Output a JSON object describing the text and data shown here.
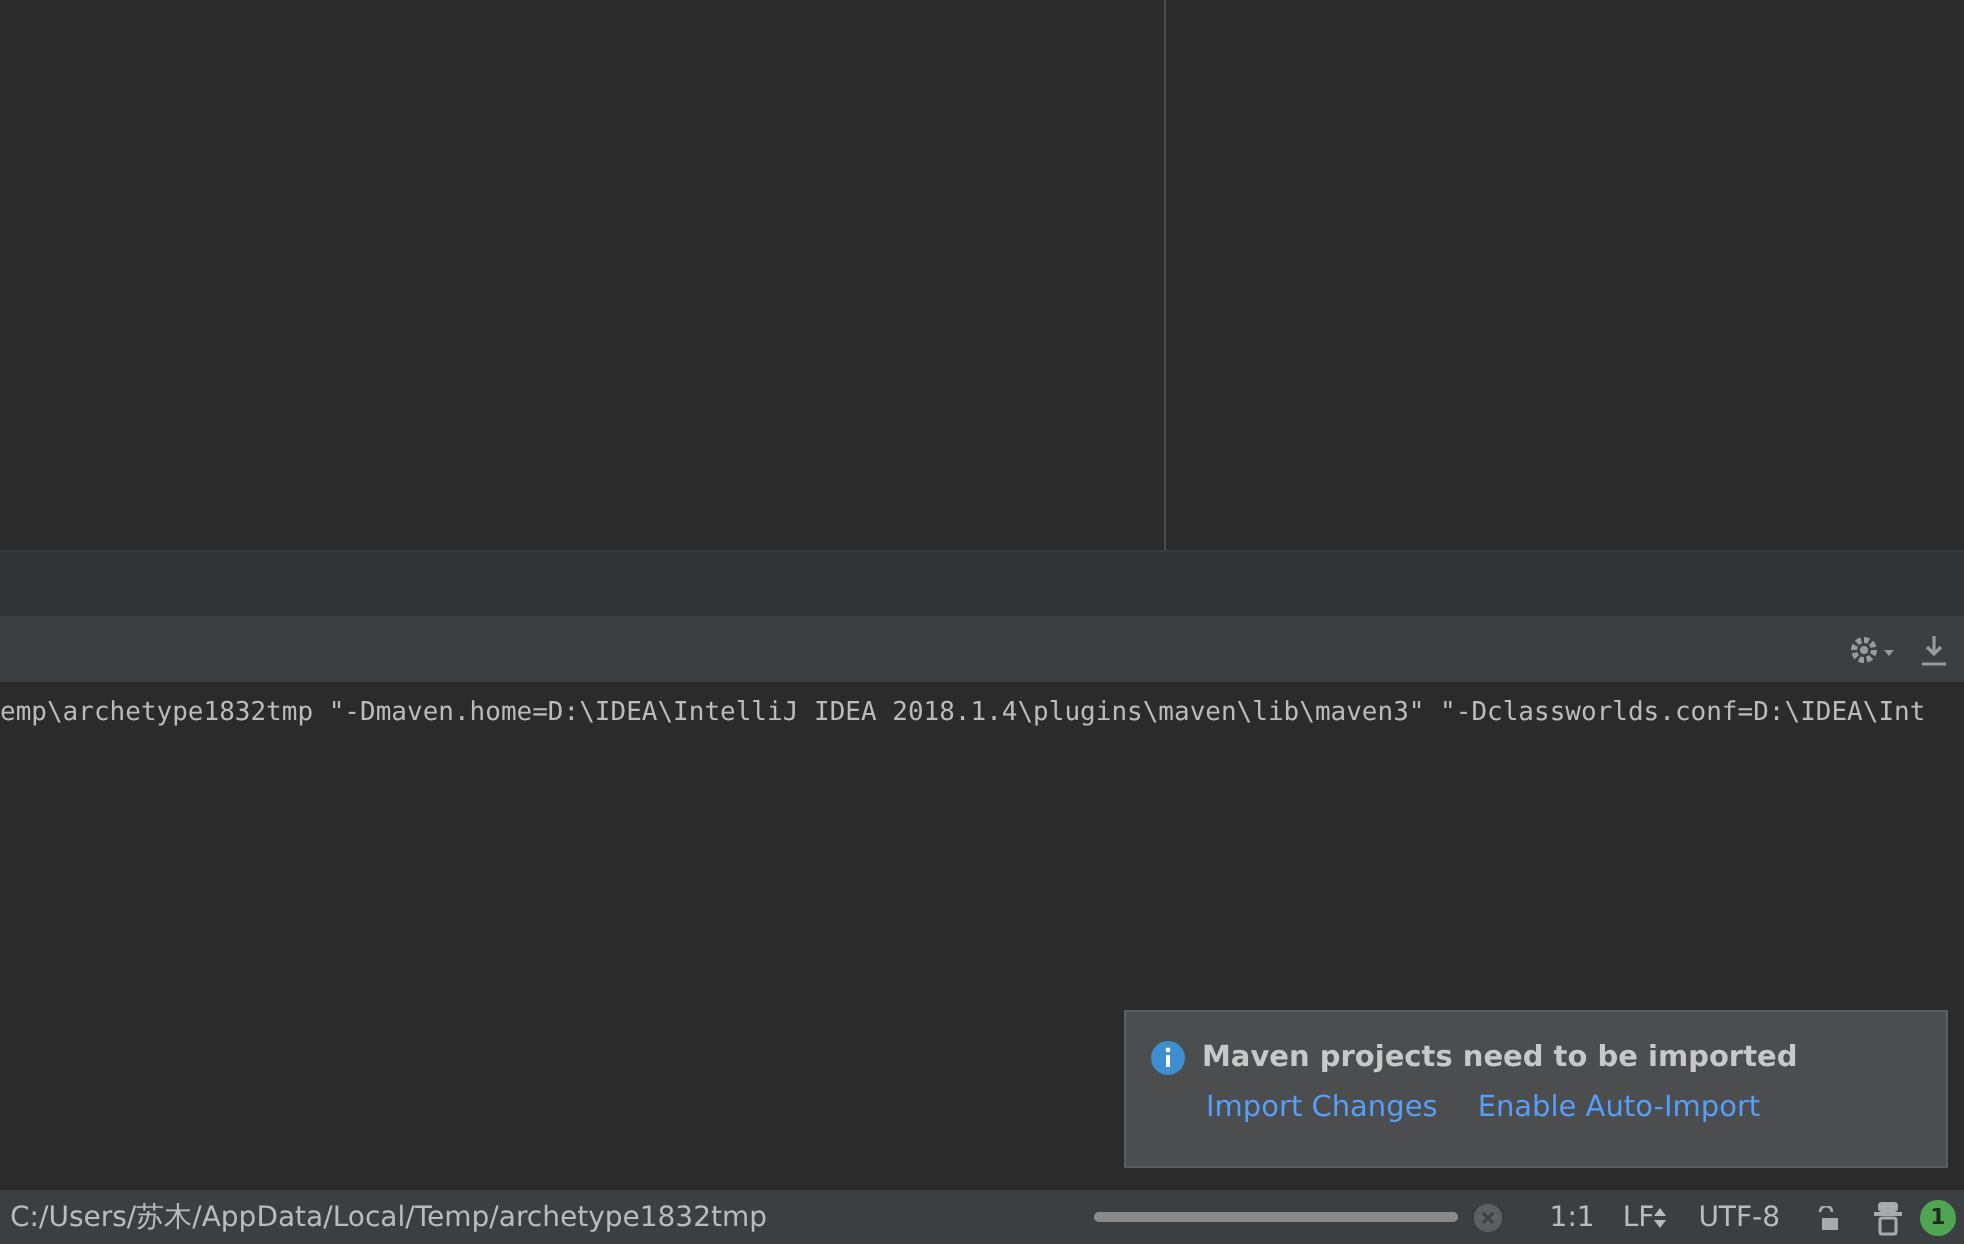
{
  "console": {
    "line": "emp\\archetype1832tmp \"-Dmaven.home=D:\\IDEA\\IntelliJ IDEA 2018.1.4\\plugins\\maven\\lib\\maven3\" \"-Dclassworlds.conf=D:\\IDEA\\Int"
  },
  "notification": {
    "title": "Maven projects need to be imported",
    "links": [
      "Import Changes",
      "Enable Auto-Import"
    ]
  },
  "status_bar": {
    "path": "C:/Users/苏木/AppData/Local/Temp/archetype1832tmp",
    "progress": {
      "level": 1
    },
    "position": "1:1",
    "line_separator": "LF",
    "encoding": "UTF-8",
    "event_count": "1"
  }
}
